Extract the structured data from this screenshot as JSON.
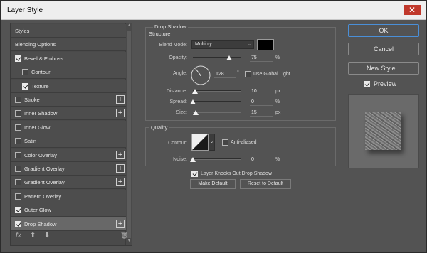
{
  "window": {
    "title": "Layer Style",
    "close_glyph": "✕"
  },
  "styles_panel": {
    "items": [
      {
        "label": "Styles",
        "checkbox": false,
        "checked": false,
        "plus": false,
        "indent": 0,
        "active": false
      },
      {
        "label": "Blending Options",
        "checkbox": false,
        "checked": false,
        "plus": false,
        "indent": 0,
        "active": false
      },
      {
        "label": "Bevel & Emboss",
        "checkbox": true,
        "checked": true,
        "plus": false,
        "indent": 0,
        "active": false
      },
      {
        "label": "Contour",
        "checkbox": true,
        "checked": false,
        "plus": false,
        "indent": 1,
        "active": false
      },
      {
        "label": "Texture",
        "checkbox": true,
        "checked": true,
        "plus": false,
        "indent": 1,
        "active": false
      },
      {
        "label": "Stroke",
        "checkbox": true,
        "checked": false,
        "plus": true,
        "indent": 0,
        "active": false
      },
      {
        "label": "Inner Shadow",
        "checkbox": true,
        "checked": false,
        "plus": true,
        "indent": 0,
        "active": false
      },
      {
        "label": "Inner Glow",
        "checkbox": true,
        "checked": false,
        "plus": false,
        "indent": 0,
        "active": false
      },
      {
        "label": "Satin",
        "checkbox": true,
        "checked": false,
        "plus": false,
        "indent": 0,
        "active": false
      },
      {
        "label": "Color Overlay",
        "checkbox": true,
        "checked": false,
        "plus": true,
        "indent": 0,
        "active": false
      },
      {
        "label": "Gradient Overlay",
        "checkbox": true,
        "checked": false,
        "plus": true,
        "indent": 0,
        "active": false
      },
      {
        "label": "Gradient Overlay",
        "checkbox": true,
        "checked": false,
        "plus": true,
        "indent": 0,
        "active": false
      },
      {
        "label": "Pattern Overlay",
        "checkbox": true,
        "checked": false,
        "plus": false,
        "indent": 0,
        "active": false
      },
      {
        "label": "Outer Glow",
        "checkbox": true,
        "checked": true,
        "plus": false,
        "indent": 0,
        "active": false
      },
      {
        "label": "Drop Shadow",
        "checkbox": true,
        "checked": true,
        "plus": true,
        "indent": 0,
        "active": true
      }
    ],
    "plus_glyph": "+",
    "bottom": {
      "fx": "fx",
      "up": "⬆",
      "down": "⬇",
      "trash": "🗑"
    }
  },
  "drop_shadow": {
    "section_title": "Drop Shadow",
    "structure_title": "Structure",
    "blend_mode": {
      "label": "Blend Mode:",
      "value": "Multiply",
      "color": "#000000"
    },
    "opacity": {
      "label": "Opacity:",
      "value": "75",
      "unit": "%",
      "level": 0.75
    },
    "angle": {
      "label": "Angle:",
      "value": "128",
      "unit": "°",
      "degrees": 128,
      "use_global_light": "Use Global Light",
      "global_checked": false
    },
    "distance": {
      "label": "Distance:",
      "value": "10",
      "unit": "px",
      "level": 0.04
    },
    "spread": {
      "label": "Spread:",
      "value": "0",
      "unit": "%",
      "level": 0.0
    },
    "size": {
      "label": "Size:",
      "value": "15",
      "unit": "px",
      "level": 0.06
    },
    "quality_title": "Quality",
    "contour": {
      "label": "Contour:",
      "anti_aliased": "Anti-aliased",
      "anti_checked": false
    },
    "noise": {
      "label": "Noise:",
      "value": "0",
      "unit": "%",
      "level": 0.0
    },
    "knocks_out": {
      "label": "Layer Knocks Out Drop Shadow",
      "checked": true
    },
    "make_default": "Make Default",
    "reset_default": "Reset to Default"
  },
  "buttons": {
    "ok": "OK",
    "cancel": "Cancel",
    "new_style": "New Style...",
    "preview": "Preview",
    "preview_checked": true
  },
  "colors": {
    "accent": "#4a8fd8",
    "panel": "#535353",
    "close": "#c0382b"
  }
}
